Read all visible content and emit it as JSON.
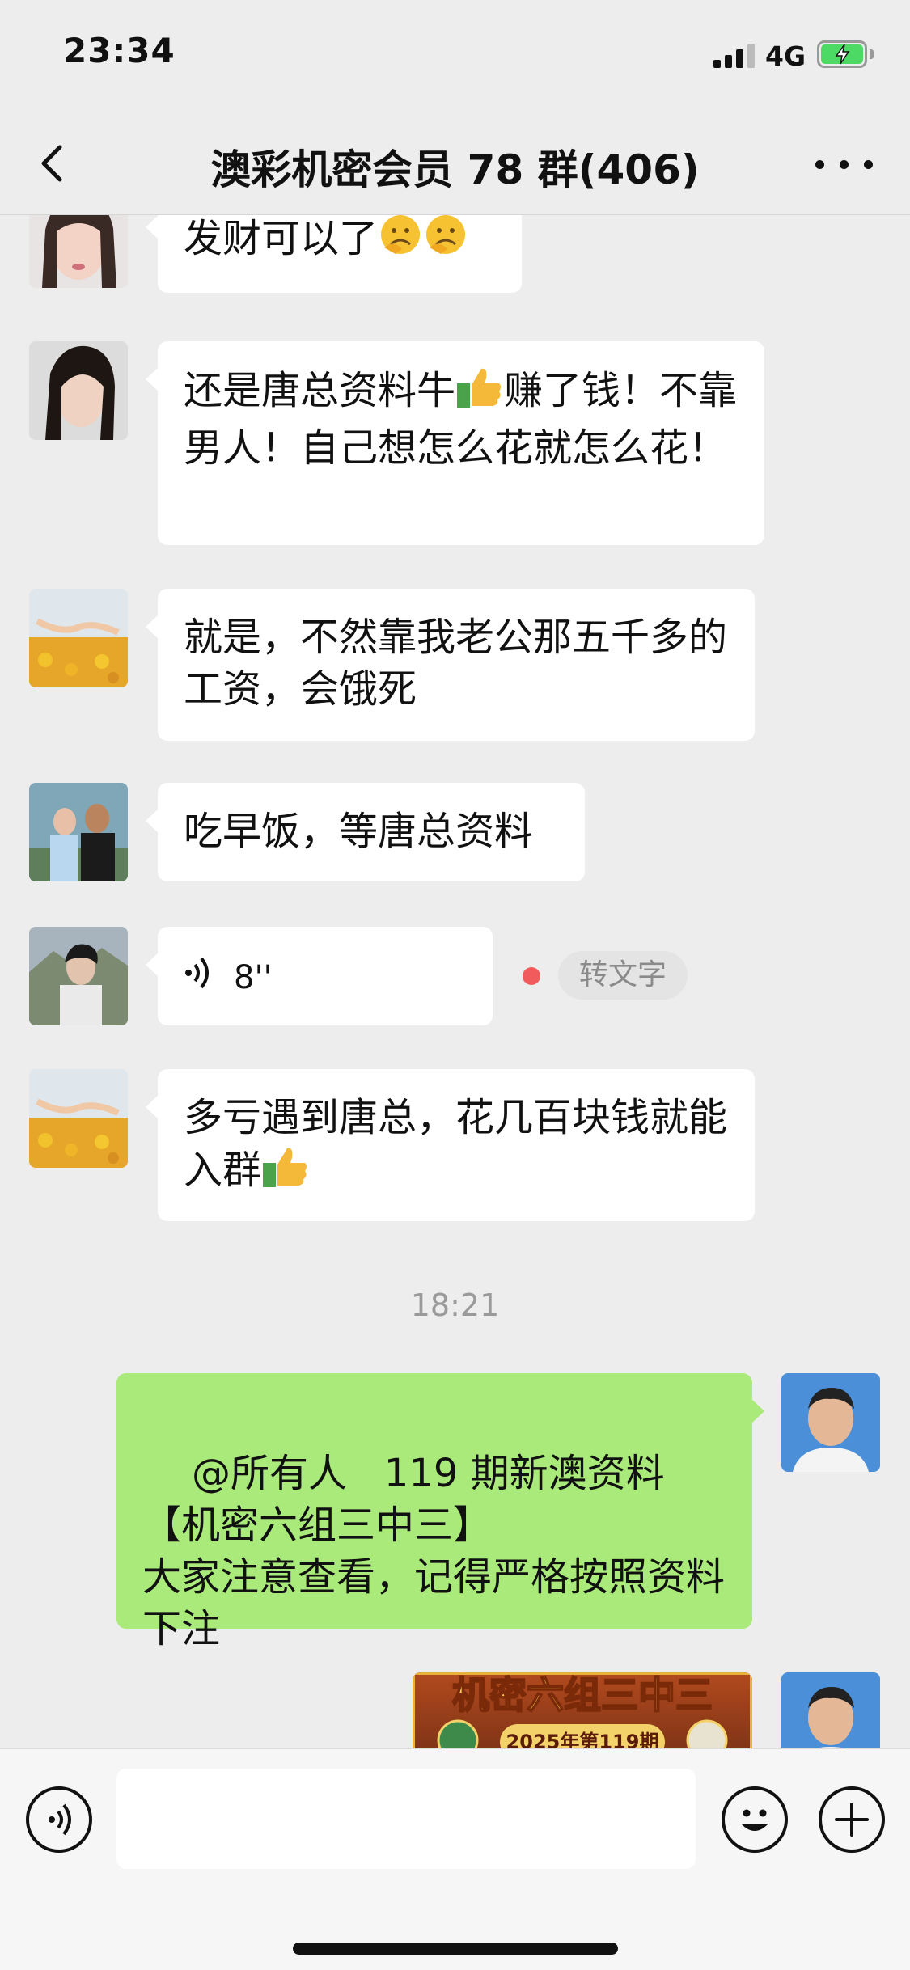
{
  "status_bar": {
    "time": "23:34",
    "network": "4G"
  },
  "nav": {
    "title": "澳彩机密会员 78 群(406)"
  },
  "messages": [
    {
      "text": "发财可以了"
    },
    {
      "text": "还是唐总资料牛",
      "text_after": "赚了钱！不靠男人！自己想怎么花就怎么花！"
    },
    {
      "text": "就是，不然靠我老公那五千多的工资，会饿死"
    },
    {
      "text": "吃早饭，等唐总资料"
    },
    {
      "voice_duration": "8''",
      "to_text_label": "转文字"
    },
    {
      "text": "多亏遇到唐总，花几百块钱就能入群"
    },
    {
      "time": "18:21"
    },
    {
      "text": "@所有人   119 期新澳资料\n【机密六组三中三】\n大家注意查看，记得严格按照资料下注"
    },
    {
      "image_title": "机密六组三中三",
      "image_subtitle": "2025年第119期"
    }
  ],
  "colors": {
    "background": "#ededed",
    "own_bubble": "#a9ea7a",
    "unread": "#f15b5b"
  },
  "icons": [
    "back-icon",
    "more-icon",
    "voice-icon",
    "emoji-icon",
    "plus-icon"
  ]
}
